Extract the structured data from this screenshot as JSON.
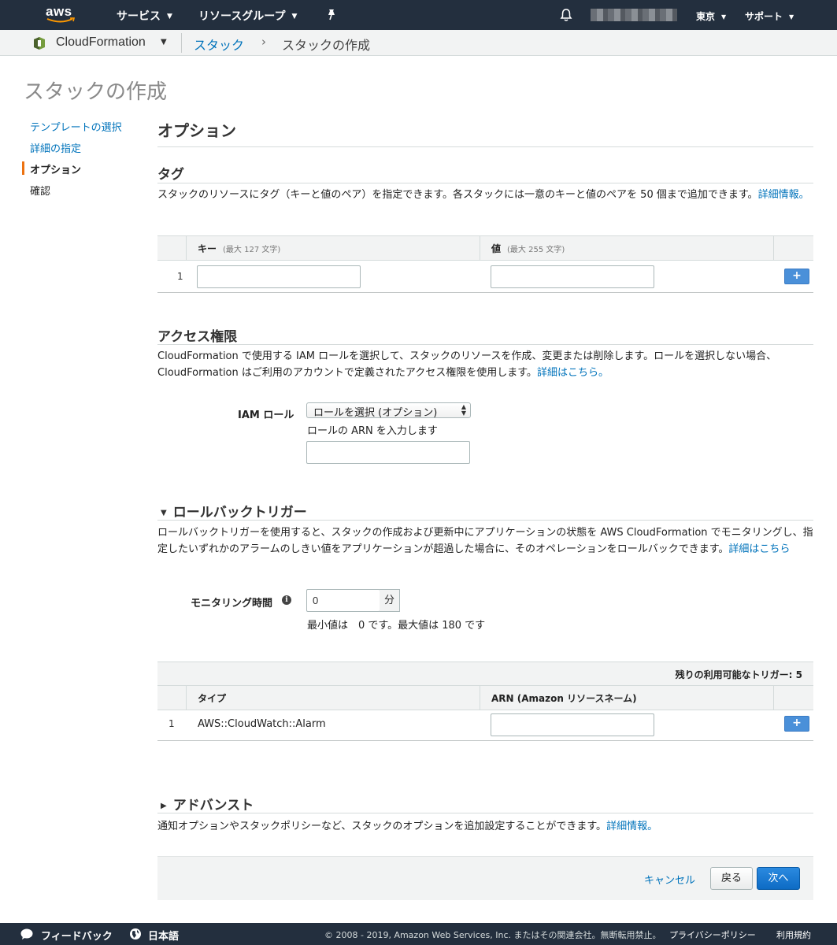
{
  "topnav": {
    "logo_text": "aws",
    "services": "サービス",
    "resource_groups": "リソースグループ",
    "region": "東京",
    "support": "サポート"
  },
  "breadcrumb": {
    "service": "CloudFormation",
    "parent": "スタック",
    "separator": "›",
    "current": "スタックの作成"
  },
  "page": {
    "title": "スタックの作成"
  },
  "sidebar": {
    "items": [
      {
        "label": "テンプレートの選択"
      },
      {
        "label": "詳細の指定"
      },
      {
        "label": "オプション"
      },
      {
        "label": "確認"
      }
    ]
  },
  "main": {
    "heading": "オプション",
    "tags": {
      "title": "タグ",
      "description": "スタックのリソースにタグ（キーと値のペア）を指定できます。各スタックには一意のキーと値のペアを 50 個まで追加できます。",
      "learn_more": "詳細情報。",
      "key_header": "キー",
      "key_hint": "(最大 127 文字)",
      "value_header": "値",
      "value_hint": "(最大 255 文字)",
      "row_number": "1",
      "add": "+"
    },
    "access": {
      "title": "アクセス権限",
      "description": "CloudFormation で使用する IAM ロールを選択して、スタックのリソースを作成、変更または削除します。ロールを選択しない場合、CloudFormation はご利用のアカウントで定義されたアクセス権限を使用します。",
      "learn_more": "詳細はこちら。",
      "iam_label": "IAM ロール",
      "iam_select": "ロールを選択 (オプション)",
      "arn_label": "ロールの ARN を入力します"
    },
    "rollback": {
      "title": "ロールバックトリガー",
      "description": "ロールバックトリガーを使用すると、スタックの作成および更新中にアプリケーションの状態を AWS CloudFormation でモニタリングし、指定したいずれかのアラームのしきい値をアプリケーションが超過した場合に、そのオペレーションをロールバックできます。",
      "learn_more": "詳細はこちら",
      "monitoring_label": "モニタリング時間",
      "monitoring_value": "0",
      "monitoring_unit": "分",
      "monitoring_hint": "最小値は　0 です。最大値は 180 です",
      "remaining": "残りの利用可能なトリガー: 5",
      "type_header": "タイプ",
      "arn_header": "ARN (Amazon リソースネーム)",
      "row_number": "1",
      "row_type": "AWS::CloudWatch::Alarm",
      "add": "+"
    },
    "advanced": {
      "title": "アドバンスト",
      "description": "通知オプションやスタックポリシーなど、スタックのオプションを追加設定することができます。",
      "learn_more": "詳細情報。"
    }
  },
  "actions": {
    "cancel": "キャンセル",
    "back": "戻る",
    "next": "次へ"
  },
  "footer": {
    "feedback": "フィードバック",
    "language": "日本語",
    "copyright": "© 2008 - 2019, Amazon Web Services, Inc. またはその関連会社。無断転用禁止。",
    "privacy": "プライバシーポリシー",
    "terms": "利用規約"
  },
  "colors": {
    "nav_bg": "#232f3e",
    "link": "#0073bb",
    "accent": "#ec7211",
    "primary_button": "#0d6bc4"
  }
}
